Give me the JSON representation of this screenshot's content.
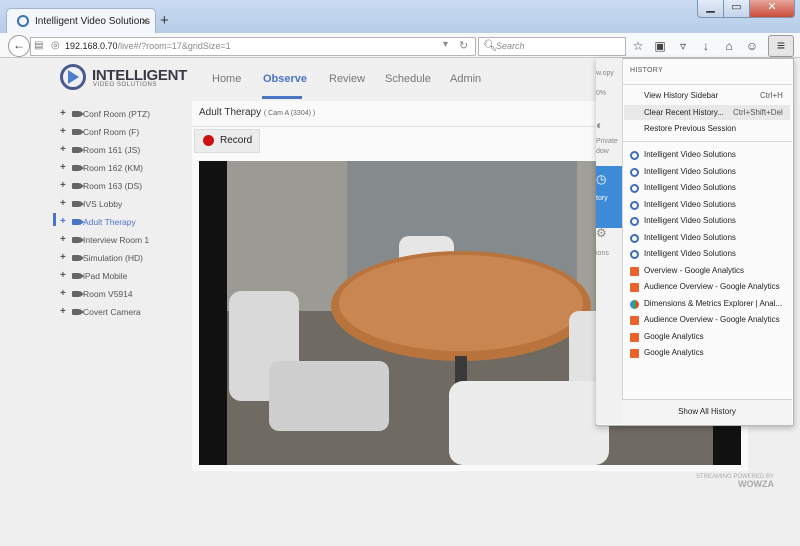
{
  "browser": {
    "tab_title": "Intelligent Video Solutions",
    "tab_close": "×",
    "new_tab": "+",
    "window_buttons": {
      "minimize": "▁",
      "maximize": "▭",
      "close": "✕"
    },
    "url_host": "192.168.0.70",
    "url_path": "/live#/?room=17&gridSize=1",
    "search_placeholder": "Search"
  },
  "site": {
    "logo_title": "INTELLIGENT",
    "logo_subtitle": "VIDEO SOLUTIONS",
    "nav": [
      "Home",
      "Observe",
      "Review",
      "Schedule",
      "Admin"
    ],
    "active_nav": "Observe"
  },
  "sidebar": {
    "cameras": [
      {
        "label": "Conf Room (PTZ)"
      },
      {
        "label": "Conf Room (F)"
      },
      {
        "label": "Room 161 (JS)"
      },
      {
        "label": "Room 162 (KM)"
      },
      {
        "label": "Room 163 (DS)"
      },
      {
        "label": "IVS Lobby"
      },
      {
        "label": "Adult Therapy"
      },
      {
        "label": "Interview Room 1"
      },
      {
        "label": "Simulation (HD)"
      },
      {
        "label": "iPad Mobile"
      },
      {
        "label": "Room V5914"
      },
      {
        "label": "Covert Camera"
      }
    ],
    "active": "Adult Therapy",
    "expand_symbol": "+"
  },
  "video_panel": {
    "title": "Adult Therapy",
    "subtitle": "( Cam A (3304) )",
    "record_label": "Record",
    "footer_line1": "STREAMING POWERED BY",
    "footer_line2": "WOWZA"
  },
  "menu_panel": {
    "strip_labels": {
      "copy": "w.opy",
      "zoom": "0%",
      "private": "Private",
      "window": "dow",
      "history": "tory",
      "options": "ions"
    },
    "header": "HISTORY",
    "items": [
      {
        "label": "View History Sidebar",
        "shortcut": "Ctrl+H"
      },
      {
        "label": "Clear Recent History...",
        "shortcut": "Ctrl+Shift+Del"
      },
      {
        "label": "Restore Previous Session",
        "shortcut": ""
      }
    ],
    "history": [
      {
        "label": "Intelligent Video Solutions",
        "icon": "ivs-icon"
      },
      {
        "label": "Intelligent Video Solutions",
        "icon": "ivs-icon"
      },
      {
        "label": "Intelligent Video Solutions",
        "icon": "ivs-icon"
      },
      {
        "label": "Intelligent Video Solutions",
        "icon": "ivs-icon"
      },
      {
        "label": "Intelligent Video Solutions",
        "icon": "ivs-icon"
      },
      {
        "label": "Intelligent Video Solutions",
        "icon": "ivs-icon"
      },
      {
        "label": "Intelligent Video Solutions",
        "icon": "ivs-icon"
      },
      {
        "label": "Overview - Google Analytics",
        "icon": "google-analytics-icon"
      },
      {
        "label": "Audience Overview - Google Analytics",
        "icon": "google-analytics-icon"
      },
      {
        "label": "Dimensions & Metrics Explorer | Anal...",
        "icon": "dimensions-metrics-icon"
      },
      {
        "label": "Audience Overview - Google Analytics",
        "icon": "google-analytics-icon"
      },
      {
        "label": "Google Analytics",
        "icon": "google-analytics-icon"
      },
      {
        "label": "Google Analytics",
        "icon": "google-analytics-icon"
      }
    ],
    "show_all": "Show All History"
  },
  "colors": {
    "accent": "#4a74c4",
    "record": "#cc1111",
    "history_highlight": "#3d8ad7"
  }
}
